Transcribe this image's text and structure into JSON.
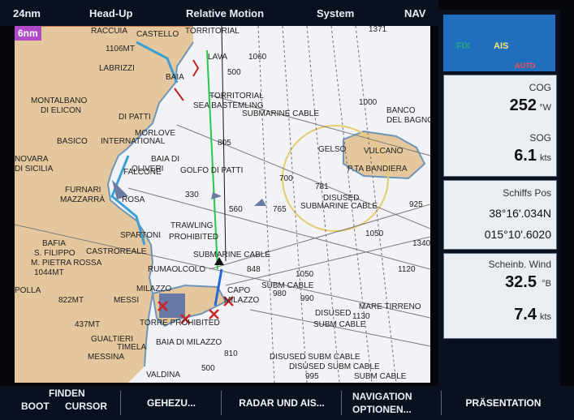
{
  "top_bar": {
    "range": "24nm",
    "orientation": "Head-Up",
    "motion": "Relative Motion",
    "system": "System",
    "mode": "NAV"
  },
  "map": {
    "range_badge": "6nm",
    "labels": [
      "RACCUIA",
      "CASTELLO",
      "TORRITORIAL",
      "1106MT",
      "LAVA",
      "1060",
      "LABRIZZI",
      "500",
      "BAIA",
      "MONTALBANO",
      "DI ELICON",
      "TORRITORIAL",
      "SEA BASTEMLING",
      "SUBMARINE CABLE",
      "1000",
      "BANCO",
      "DEL BAGNO",
      "DI PATTI",
      "BASICO",
      "MORLOVE",
      "INTERNATIONAL",
      "805",
      "GELSO",
      "VULCANO",
      "P.TA BANDIERA",
      "BAIA DI",
      "OLIVERI",
      "GOLFO DI PATTI",
      "700",
      "781",
      "DISUSED",
      "FALCONE",
      "NOVARA",
      "DI SICILIA",
      "FURNARI",
      "MAZZARRÀ",
      "ROSA",
      "330",
      "560",
      "765",
      "SUBMARINE CABLE",
      "TRAWLING",
      "PROHIBITED",
      "1050",
      "BAFIA",
      "CASTROREALE",
      "SPARTONI",
      "S. FILIPPO",
      "M. PIETRA ROSSA",
      "1044MT",
      "SUBMARINE CABLE",
      "848",
      "RUMAOLCOLO",
      "1120",
      "POLLA",
      "CAPO",
      "MILAZZO",
      "1050",
      "SUBM CABLE",
      "822MT",
      "MESSI",
      "MILAZZO",
      "980",
      "990",
      "MARE TIRRENO",
      "DISUSED",
      "1130",
      "437MT",
      "TORRE PROHIBITED",
      "SUBM CABLE",
      "GUALTIERI",
      "TIMELA",
      "BAIA DI MILAZZO",
      "MESSINA",
      "DISUSED SUBM CABLE",
      "DISUSED SUBM CABLE",
      "995",
      "SUBM CABLE",
      "VALDINA",
      "500",
      "810",
      "1371",
      "1340",
      "925"
    ]
  },
  "right_panel": {
    "icons": {
      "fix": "FIX",
      "ais": "AIS",
      "auto": "AUTO"
    },
    "cog": {
      "label": "COG",
      "value": "252",
      "unit": "°W"
    },
    "sog": {
      "label": "SOG",
      "value": "6.1",
      "unit": "kts"
    },
    "position": {
      "label": "Schiffs Pos",
      "lat": "38°16'.034N",
      "lon": "015°10'.6020"
    },
    "wind": {
      "label": "Scheinb. Wind",
      "speed": "32.5",
      "speed_unit": "°B",
      "kts": "7.4",
      "kts_unit": "kts"
    }
  },
  "bottom_bar": {
    "finden": "FINDEN",
    "boot": "BOOT",
    "cursor": "CURSOR",
    "gehezu": "GEHEZU...",
    "radar": "RADAR UND AIS...",
    "navigation_top": "NAVIGATION",
    "navigation_bottom": "OPTIONEN...",
    "praesentation": "PRÄSENTATION"
  }
}
